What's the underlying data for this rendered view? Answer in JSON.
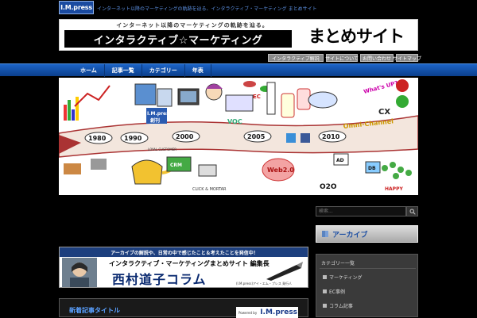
{
  "topbar": {
    "logo": "I.M.press",
    "tagline": "インターネット以降のマーケティングの軌跡を辿る、インタラクティブ・マーケティング まとめサイト"
  },
  "header": {
    "subtitle": "インターネット以降のマーケティングの軌跡を辿る。",
    "title": "インタラクティブ☆マーケティング",
    "title_right": "まとめサイト"
  },
  "sublinks": [
    "インタラクティブ解説",
    "サイトについて",
    "お問い合わせ",
    "サイトマップ"
  ],
  "nav": [
    "ホーム",
    "記事一覧",
    "カテゴリー",
    "年表"
  ],
  "banner": {
    "magazine": "I.M.press",
    "magazine_sub": "創刊",
    "years": [
      "1980",
      "1990",
      "2000",
      "2005",
      "2010"
    ],
    "labels": {
      "voc": "VOC",
      "ec": "EC",
      "whats_up": "What's UP?",
      "cx": "CX",
      "omni": "Omni-Channel",
      "web20": "Web2.0",
      "o2o": "O2O",
      "happy": "HAPPY",
      "loyal": "LOYAL CUSTOMER",
      "click": "CLICK & MORTAR",
      "crm": "CRM",
      "db": "DB",
      "ad": "AD"
    }
  },
  "search": {
    "placeholder": "検索..."
  },
  "archive": {
    "label": "アーカイブ"
  },
  "category": {
    "title": "カテゴリー一覧",
    "items": [
      "マーケティング",
      "EC事例",
      "コラム記事"
    ]
  },
  "column_banner": {
    "strip": "アーカイブの解説や、日常の中で感じたこと＆考えたことを発信中！",
    "title1": "インタラクティブ・マーケティングまとめサイト 編集長",
    "title2": "西村道子コラム",
    "note": "(I.M.press)アイ・エム・プレス 発行人"
  },
  "bottom": {
    "title": "新着記事タイトル",
    "powered_by": "Powered by",
    "powered_logo": "I.M.press"
  },
  "colors": {
    "nav": "#1c63c6",
    "accent": "#5b8fe0",
    "background": "#000000"
  }
}
